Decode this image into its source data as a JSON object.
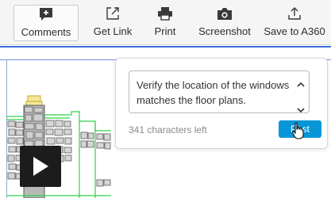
{
  "toolbar": {
    "items": [
      {
        "label": "Comments",
        "icon": "comment-add-icon",
        "active": true
      },
      {
        "label": "Get Link",
        "icon": "external-link-icon"
      },
      {
        "label": "Print",
        "icon": "printer-icon"
      },
      {
        "label": "Screenshot",
        "icon": "camera-icon"
      },
      {
        "label": "Save to A360",
        "icon": "upload-icon"
      }
    ]
  },
  "comment_panel": {
    "text": "Verify the location of the windows matches the floor plans.",
    "chars_left": "341 characters left",
    "post_label": "Post"
  },
  "colors": {
    "accent": "#0696d7",
    "cad_blue": "#3c6fd6",
    "cad_green": "#2fd24a"
  }
}
